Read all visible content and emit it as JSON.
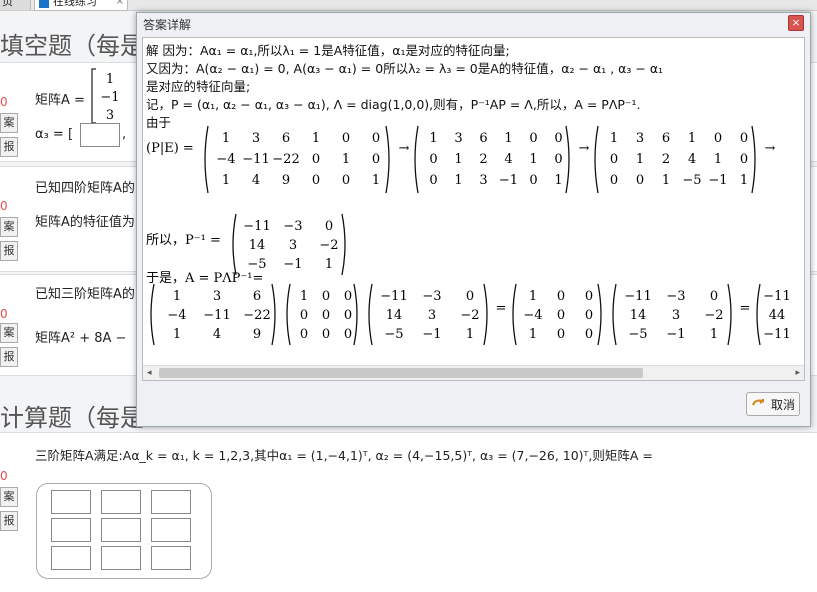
{
  "tabs": {
    "first": "页",
    "active": "在线练习",
    "close": "×"
  },
  "sections": {
    "fill": "填空题（每是",
    "calc": "计算题（每是"
  },
  "q1": {
    "num": "0",
    "btn1": "案",
    "btn2": "报",
    "text": "矩阵A =",
    "vec": [
      "1",
      "−1",
      "3"
    ],
    "alpha3": "α₃ = ["
  },
  "q2": {
    "num": "0",
    "btn1": "案",
    "btn2": "报",
    "line1": "已知四阶矩阵A的",
    "line2": "矩阵A的特征值为"
  },
  "q3": {
    "num": "0",
    "btn1": "案",
    "btn2": "报",
    "line1": "已知三阶矩阵A的",
    "line2": "矩阵A² + 8A −"
  },
  "q4": {
    "num": "0",
    "btn1": "案",
    "btn2": "报",
    "text": "三阶矩阵A满足:Aα_k = α₁, k = 1,2,3,其中α₁ = (1,−4,1)ᵀ, α₂ = (4,−15,5)ᵀ, α₃ = (7,−26, 10)ᵀ,则矩阵A ="
  },
  "modal": {
    "title": "答案详解",
    "close": "×",
    "cancel": "取消",
    "l1": "解 因为：Aα₁ = α₁,所以λ₁ = 1是A特征值，α₁是对应的特征向量;",
    "l2": "又因为：A(α₂ − α₁) = 0, A(α₃ − α₁) = 0所以λ₂ = λ₃ = 0是A的特征值，α₂ − α₁ , α₃ − α₁",
    "l3": "是对应的特征向量;",
    "l4": "记，P = (α₁, α₂ − α₁, α₃ − α₁), Λ = diag(1,0,0),则有，P⁻¹AP = Λ,所以，A = PΛP⁻¹.",
    "l5": "由于",
    "pe": "(P|E) =",
    "m1": [
      [
        "1",
        "3",
        "6",
        "1",
        "0",
        "0"
      ],
      [
        "−4",
        "−11",
        "−22",
        "0",
        "1",
        "0"
      ],
      [
        "1",
        "4",
        "9",
        "0",
        "0",
        "1"
      ]
    ],
    "m2": [
      [
        "1",
        "3",
        "6",
        "1",
        "0",
        "0"
      ],
      [
        "0",
        "1",
        "2",
        "4",
        "1",
        "0"
      ],
      [
        "0",
        "1",
        "3",
        "−1",
        "0",
        "1"
      ]
    ],
    "m3": [
      [
        "1",
        "3",
        "6",
        "1",
        "0",
        "0"
      ],
      [
        "0",
        "1",
        "2",
        "4",
        "1",
        "0"
      ],
      [
        "0",
        "0",
        "1",
        "−5",
        "−1",
        "1"
      ]
    ],
    "arrow": "→",
    "l6": "所以，P⁻¹ =",
    "pinv": [
      [
        "−11",
        "−3",
        "0"
      ],
      [
        "14",
        "3",
        "−2"
      ],
      [
        "−5",
        "−1",
        "1"
      ]
    ],
    "l7": "于是，A = PΛP⁻¹=",
    "p": [
      [
        "1",
        "3",
        "6"
      ],
      [
        "−4",
        "−11",
        "−22"
      ],
      [
        "1",
        "4",
        "9"
      ]
    ],
    "lam": [
      [
        "1",
        "0",
        "0"
      ],
      [
        "0",
        "0",
        "0"
      ],
      [
        "0",
        "0",
        "0"
      ]
    ],
    "pinv2": [
      [
        "−11",
        "−3",
        "0"
      ],
      [
        "14",
        "3",
        "−2"
      ],
      [
        "−5",
        "−1",
        "1"
      ]
    ],
    "eq": "=",
    "q": [
      [
        "1",
        "0",
        "0"
      ],
      [
        "−4",
        "0",
        "0"
      ],
      [
        "1",
        "0",
        "0"
      ]
    ],
    "pinv3": [
      [
        "−11",
        "−3",
        "0"
      ],
      [
        "14",
        "3",
        "−2"
      ],
      [
        "−5",
        "−1",
        "1"
      ]
    ],
    "res": [
      "−11",
      "44",
      "−11"
    ]
  }
}
